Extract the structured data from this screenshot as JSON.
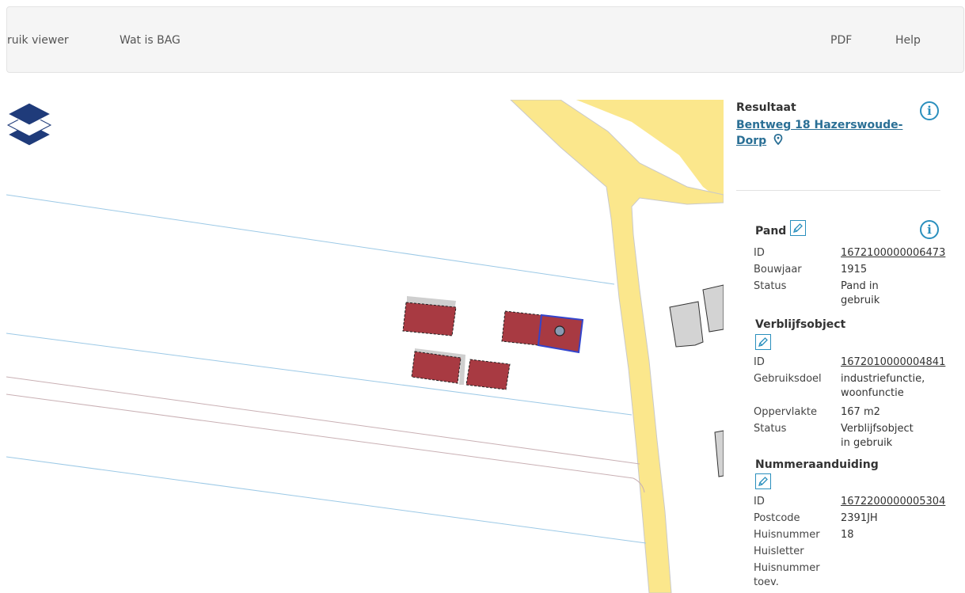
{
  "nav": {
    "items": [
      "ruik viewer",
      "Wat is BAG"
    ],
    "right_items": [
      "PDF",
      "Help"
    ]
  },
  "map": {
    "icons": {
      "layers": "layers-icon",
      "address_point": "address-marker-icon"
    },
    "colors": {
      "road": "#fbe78c",
      "water": "#8ec8e8",
      "building_selected": "#a83a42",
      "building_other": "#c8c8c8",
      "parcel_line": "#9cc9e6"
    }
  },
  "result": {
    "heading": "Resultaat",
    "address_line1": "Bentweg 18 Hazerswoude-",
    "address_line2": "Dorp"
  },
  "pand": {
    "title": "Pand",
    "rows": [
      {
        "label": "ID",
        "value": "1672100000006473"
      },
      {
        "label": "Bouwjaar",
        "value": "1915"
      },
      {
        "label": "Status",
        "value": "Pand in",
        "value2": "gebruik"
      }
    ]
  },
  "verblijfsobject": {
    "title": "Verblijfsobject",
    "rows": [
      {
        "label": "ID",
        "value": "1672010000004841"
      },
      {
        "label": "Gebruiksdoel",
        "value": "industriefunctie,",
        "value2": "woonfunctie"
      },
      {
        "label": "Oppervlakte",
        "value": "167 m2"
      },
      {
        "label": "Status",
        "value": "Verblijfsobject",
        "value2": "in gebruik"
      }
    ]
  },
  "nummeraanduiding": {
    "title": "Nummeraanduiding",
    "rows": [
      {
        "label": "ID",
        "value": "1672200000005304"
      },
      {
        "label": "Postcode",
        "value": "2391JH"
      },
      {
        "label": "Huisnummer",
        "value": "18"
      },
      {
        "label": "Huisletter",
        "value": ""
      },
      {
        "label": "Huisnummer",
        "label2": "toev.",
        "value": ""
      }
    ]
  },
  "icons": {
    "info": "i",
    "edit": "pencil-icon",
    "marker": "map-marker-icon"
  }
}
